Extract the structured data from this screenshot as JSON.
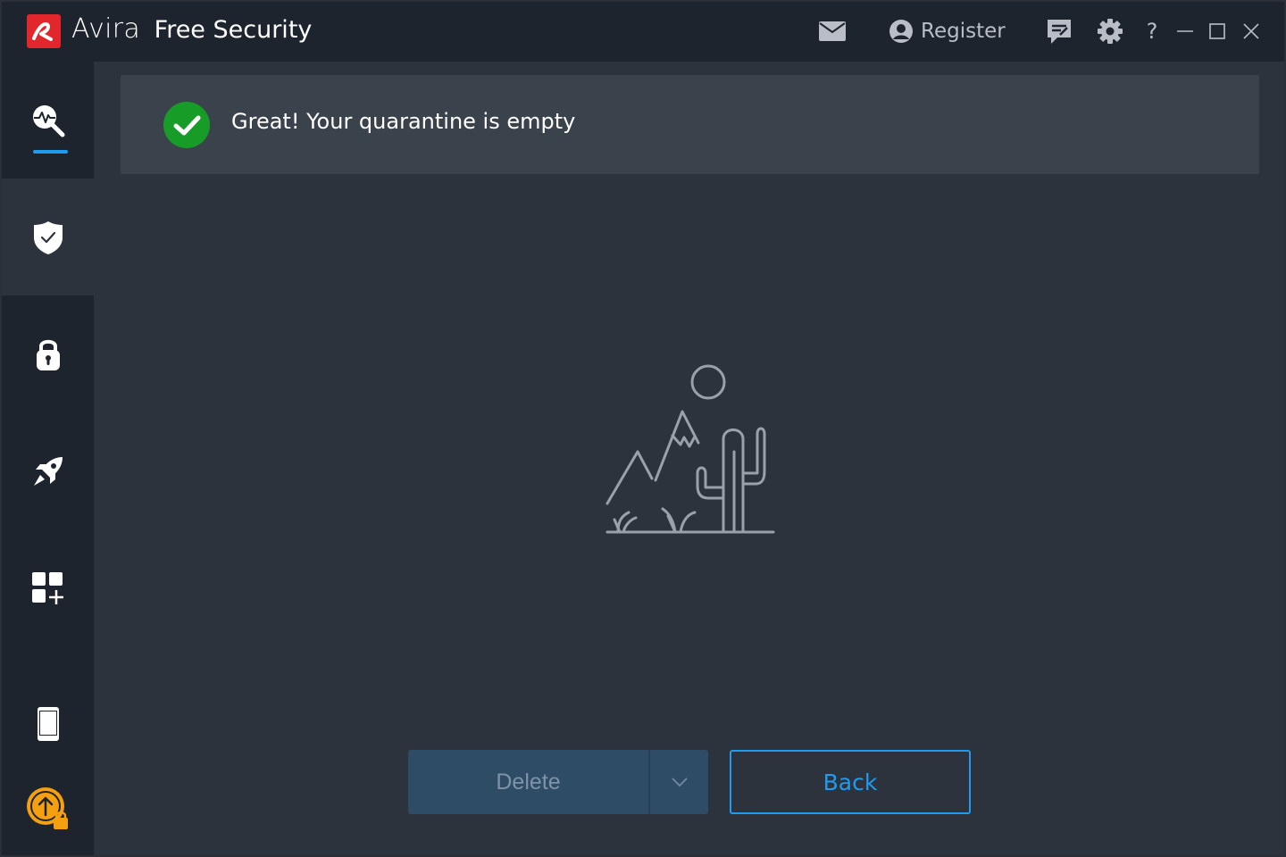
{
  "titlebar": {
    "brand": "Avira",
    "product": "Free Security",
    "register_label": "Register",
    "help_label": "?"
  },
  "sidebar": {
    "items": [
      {
        "name": "scan",
        "icon": "scan-pulse-icon",
        "active": false,
        "indicator": true
      },
      {
        "name": "security",
        "icon": "shield-check-icon",
        "active": true
      },
      {
        "name": "privacy",
        "icon": "lock-icon",
        "active": false
      },
      {
        "name": "performance",
        "icon": "rocket-icon",
        "active": false
      },
      {
        "name": "apps",
        "icon": "apps-add-icon",
        "active": false
      },
      {
        "name": "mobile",
        "icon": "smartphone-icon",
        "active": false
      },
      {
        "name": "upgrade",
        "icon": "upgrade-lock-icon",
        "active": false
      }
    ]
  },
  "main": {
    "banner_text": "Great! Your quarantine is empty",
    "illustration": "desert-empty-illustration",
    "delete_label": "Delete",
    "back_label": "Back"
  },
  "colors": {
    "accent": "#1f9bf0",
    "success": "#189c28",
    "brand": "#e1262c",
    "upgrade": "#f4a010"
  }
}
